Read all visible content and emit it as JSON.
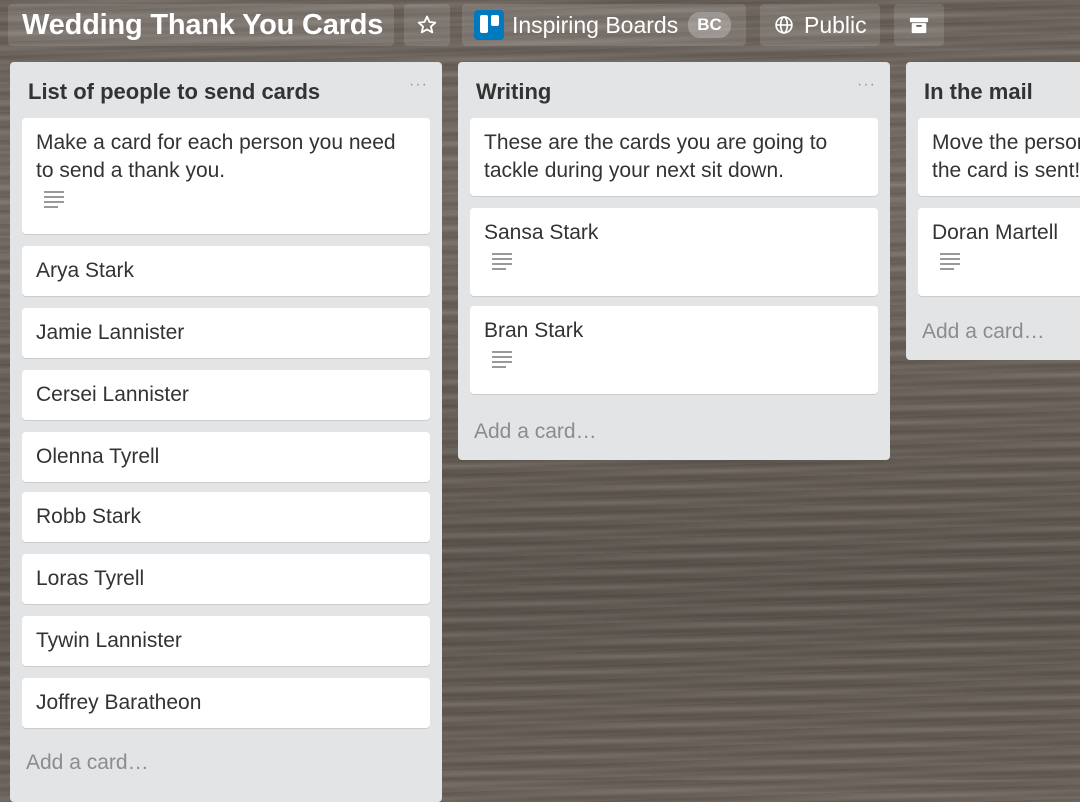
{
  "board": {
    "title": "Wedding Thank You Cards",
    "team_name": "Inspiring Boards",
    "team_badge": "BC",
    "visibility": "Public"
  },
  "icons": {
    "star": "star-icon",
    "team": "trello-logo-icon",
    "visibility": "globe-icon",
    "archive": "archive-icon",
    "description": "description-icon"
  },
  "lists": [
    {
      "title": "List of people to send cards",
      "menu": "···",
      "add_card": "Add a card…",
      "cards": [
        {
          "text": "Make a card for each person you need to send a thank you."
        },
        {
          "text": "Arya Stark"
        },
        {
          "text": "Jamie Lannister"
        },
        {
          "text": "Cersei Lannister"
        },
        {
          "text": "Olenna Tyrell"
        },
        {
          "text": "Robb Stark"
        },
        {
          "text": "Loras Tyrell"
        },
        {
          "text": "Tywin Lannister"
        },
        {
          "text": "Joffrey Baratheon"
        }
      ]
    },
    {
      "title": "Writing",
      "menu": "···",
      "add_card": "Add a card…",
      "cards": [
        {
          "text": "These are the cards you are going to tackle during your next sit down."
        },
        {
          "text": "Sansa Stark"
        },
        {
          "text": "Bran Stark"
        }
      ]
    },
    {
      "title": "In the mail",
      "add_card": "Add a card…",
      "cards": [
        {
          "text": "Move the person here once the card is sent!"
        },
        {
          "text": "Doran Martell"
        }
      ]
    }
  ]
}
